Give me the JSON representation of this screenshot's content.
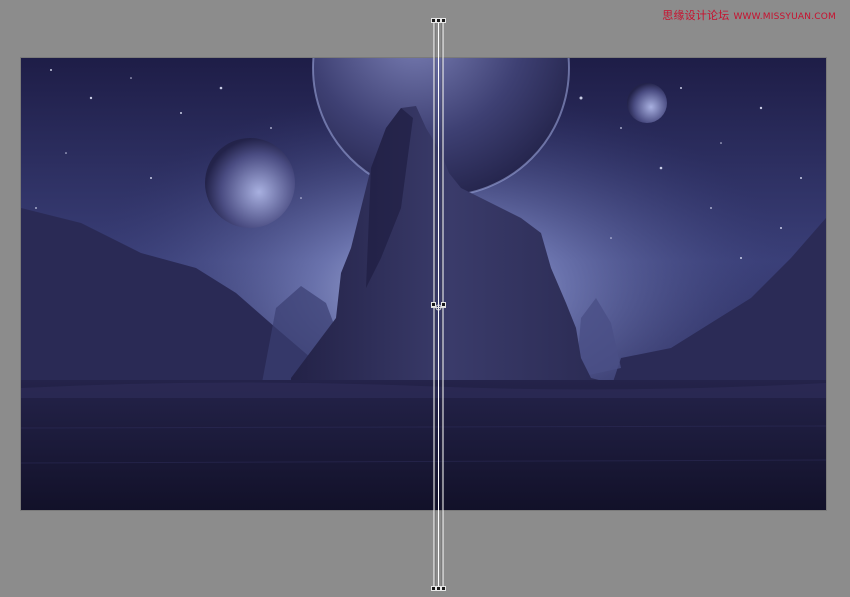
{
  "watermark": {
    "text": "思缘设计论坛",
    "site": "WWW.MISSYUAN.COM"
  },
  "canvas": {
    "background_color": "#1f1e44",
    "workspace_color": "#8c8c8c",
    "content": "night landscape photo"
  },
  "transform": {
    "guide_color": "#ffffff",
    "handle_color": "#1a1a1a"
  }
}
